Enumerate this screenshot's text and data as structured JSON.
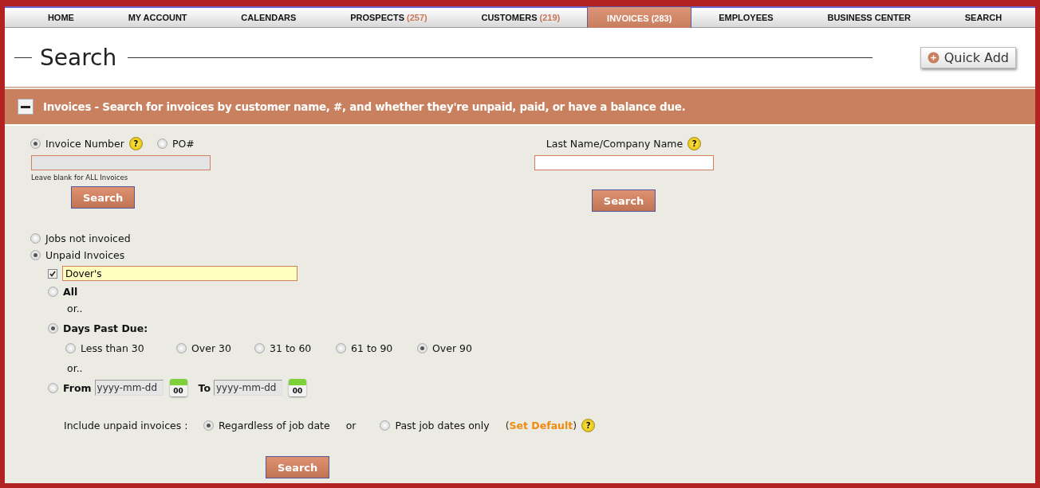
{
  "nav": [
    {
      "label": "HOME",
      "selected": false
    },
    {
      "label": "MY ACCOUNT",
      "selected": false
    },
    {
      "label": "CALENDARS",
      "selected": false
    },
    {
      "label": "PROSPECTS",
      "count": "(257)",
      "selected": false
    },
    {
      "label": "CUSTOMERS",
      "count": "(219)",
      "selected": false
    },
    {
      "label": "INVOICES",
      "count": "(283)",
      "selected": true
    },
    {
      "label": "EMPLOYEES",
      "selected": false
    },
    {
      "label": "BUSINESS CENTER",
      "selected": false
    },
    {
      "label": "SEARCH",
      "selected": false
    }
  ],
  "page_title": "Search",
  "quick_add": "Quick Add",
  "section": {
    "title": "Invoices - Search for invoices by customer name, #, and whether they're unpaid, paid, or have a balance due.",
    "expanded": true
  },
  "invoice_search": {
    "types": [
      {
        "label": "Invoice Number",
        "selected": true,
        "help": "?"
      },
      {
        "label": "PO#",
        "selected": false
      }
    ],
    "hint": "Leave blank for ALL Invoices",
    "button": "Search"
  },
  "name_search": {
    "label": "Last Name/Company Name",
    "help": "?",
    "button": "Search"
  },
  "status_options": [
    {
      "label": "Jobs not invoiced",
      "selected": false
    },
    {
      "label": "Unpaid Invoices",
      "selected": true
    }
  ],
  "customer_filter": {
    "checked": true,
    "value": "Dover's"
  },
  "all_option": {
    "label": "All",
    "selected": false
  },
  "or_1": "or..",
  "days_past_due": {
    "label": "Days Past Due:",
    "selected": true,
    "options": [
      {
        "label": "Less than 30",
        "selected": false
      },
      {
        "label": "Over 30",
        "selected": false
      },
      {
        "label": "31 to 60",
        "selected": false
      },
      {
        "label": "61 to 90",
        "selected": false
      },
      {
        "label": "Over 90",
        "selected": true
      }
    ]
  },
  "or_2": "or..",
  "date_range": {
    "selected": false,
    "from_label": "From",
    "from_placeholder": "yyyy-mm-dd",
    "to_label": "To",
    "to_placeholder": "yyyy-mm-dd",
    "from_calendar": "00",
    "to_calendar": "00"
  },
  "include": {
    "label": "Include unpaid invoices :",
    "options": [
      {
        "label": "Regardless of job date",
        "selected": true
      },
      {
        "label": "Past job dates only",
        "selected": false
      }
    ],
    "or_text": "or",
    "open_paren": "(",
    "set_default": "Set Default",
    "close_paren": ")",
    "help": "?"
  },
  "bottom_button": "Search"
}
